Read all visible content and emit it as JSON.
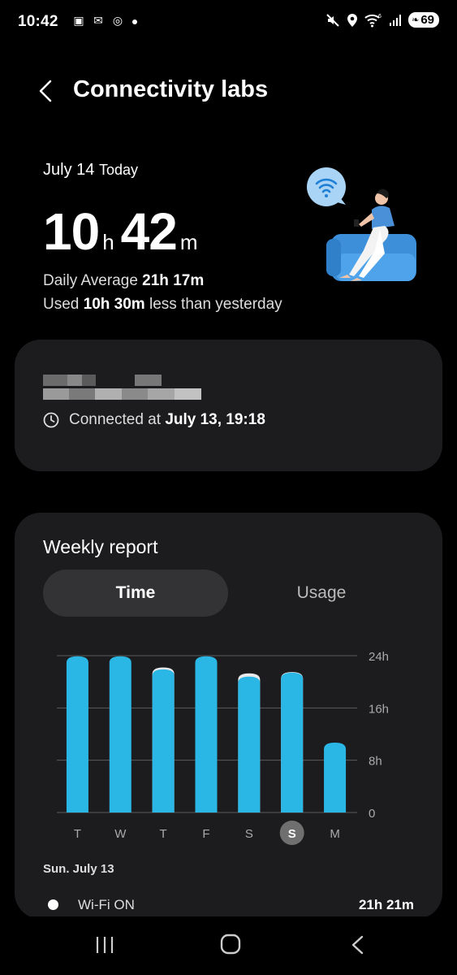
{
  "status_bar": {
    "time": "10:42",
    "battery": "69",
    "icons_left": [
      "screenshot-icon",
      "messenger-icon",
      "accessibility-icon",
      "notification-dot"
    ],
    "icons_right": [
      "mute-icon",
      "location-icon",
      "wifi-6-icon",
      "signal-icon",
      "battery-icon"
    ]
  },
  "header": {
    "title": "Connectivity labs",
    "back_icon": "chevron-left-icon"
  },
  "summary": {
    "date": "July 14",
    "today_label": "Today",
    "hours": "10",
    "hours_unit": "h",
    "minutes": "42",
    "minutes_unit": "m",
    "avg_label": "Daily Average",
    "avg_value": "21h 17m",
    "used_prefix": "Used",
    "used_value": "10h 30m",
    "used_suffix": "less than yesterday"
  },
  "connection": {
    "network_name_redacted": true,
    "connected_prefix": "Connected at",
    "connected_value": "July 13, 19:18"
  },
  "weekly": {
    "title": "Weekly report",
    "tabs": [
      "Time",
      "Usage"
    ],
    "selected_tab": "Time",
    "selected_date": "Sun. July 13",
    "legend_label": "Wi-Fi ON",
    "legend_value": "21h 21m"
  },
  "chart_data": {
    "type": "bar",
    "categories": [
      "T",
      "W",
      "T",
      "F",
      "S",
      "S",
      "M"
    ],
    "selected_index": 5,
    "series": [
      {
        "values": [
          23.9,
          23.9,
          21.9,
          23.9,
          20.8,
          21.4,
          10.7
        ]
      }
    ],
    "total_values": [
      23.9,
      23.9,
      22.2,
      23.9,
      21.3,
      21.5,
      10.7
    ],
    "yticks": [
      "24h",
      "16h",
      "8h",
      "0"
    ],
    "ylim": [
      0,
      24
    ],
    "grid": true,
    "colors": {
      "bar": "#2bb7e6",
      "cap": "#e9e9e9",
      "grid": "#5a5a5a"
    }
  },
  "nav": {
    "recents_icon": "recents-icon",
    "home_icon": "home-icon",
    "back_icon": "back-icon"
  }
}
